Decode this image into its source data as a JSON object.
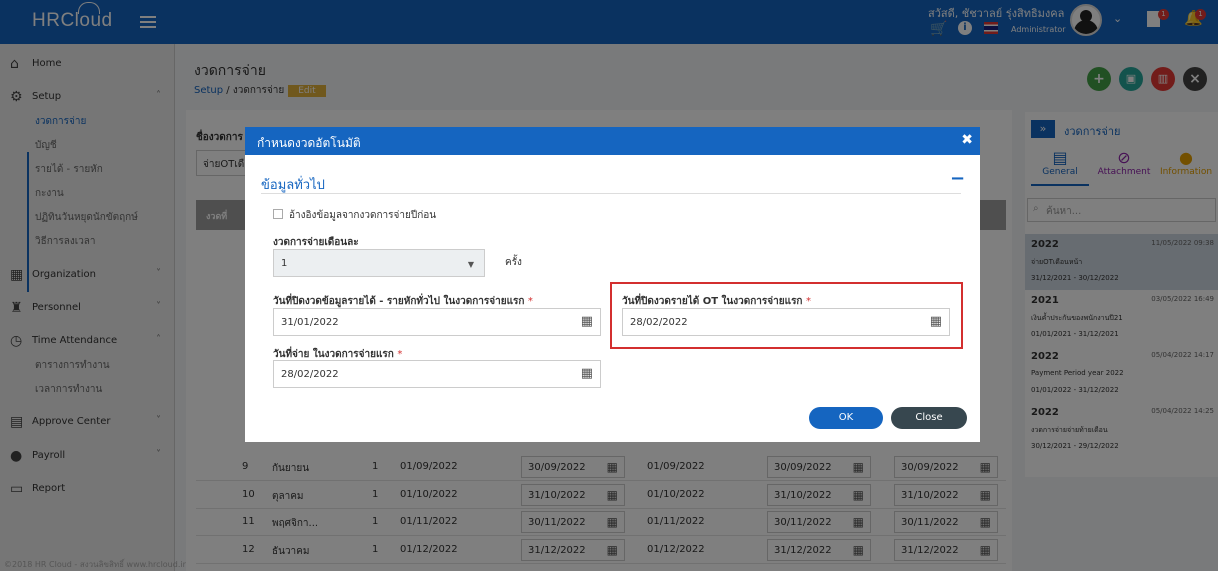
{
  "app": {
    "logo": "HRCloud",
    "username": "สวัสดี, ชัชวาลย์ รุ่งสิทธิมงคล",
    "role": "Administrator",
    "doc_badge": "1",
    "bell_badge": "1"
  },
  "sidebar": {
    "items": [
      {
        "label": "Home",
        "icon": "home-icon"
      },
      {
        "label": "Setup",
        "icon": "gear-icon"
      },
      {
        "label": "Organization",
        "icon": "building-icon"
      },
      {
        "label": "Personnel",
        "icon": "people-icon"
      },
      {
        "label": "Time Attendance",
        "icon": "clock-icon"
      },
      {
        "label": "Approve Center",
        "icon": "clipboard-icon"
      },
      {
        "label": "Payroll",
        "icon": "money-bag-icon"
      },
      {
        "label": "Report",
        "icon": "document-icon"
      }
    ],
    "setup_sub": [
      "งวดการจ่าย",
      "บัญชี",
      "รายได้ - รายหัก",
      "กะงาน",
      "ปฏิทินวันหยุดนักขัตฤกษ์",
      "วิธีการลงเวลา"
    ],
    "time_sub": [
      "ตารางการทำงาน",
      "เวลาการทำงาน"
    ],
    "footer": "©2018 HR Cloud - สงวนลิขสิทธิ์ www.hrcloud.in.th"
  },
  "page": {
    "title": "งวดการจ่าย",
    "breadcrumb_root": "Setup",
    "breadcrumb_sep": "/",
    "breadcrumb_current": "งวดการจ่าย",
    "mode": "Edit",
    "form_label": "ชื่องวดการ",
    "form_value": "จ่ายOTเดือ",
    "table_first_col": "งวดที่"
  },
  "table": {
    "rows": [
      {
        "no": "9",
        "month": "กันยายน",
        "times": "1",
        "start": "01/09/2022",
        "end": "30/09/2022",
        "ot_start": "01/09/2022",
        "ot_end": "30/09/2022",
        "pay": "30/09/2022"
      },
      {
        "no": "10",
        "month": "ตุลาคม",
        "times": "1",
        "start": "01/10/2022",
        "end": "31/10/2022",
        "ot_start": "01/10/2022",
        "ot_end": "31/10/2022",
        "pay": "31/10/2022"
      },
      {
        "no": "11",
        "month": "พฤศจิกา...",
        "times": "1",
        "start": "01/11/2022",
        "end": "30/11/2022",
        "ot_start": "01/11/2022",
        "ot_end": "30/11/2022",
        "pay": "30/11/2022"
      },
      {
        "no": "12",
        "month": "ธันวาคม",
        "times": "1",
        "start": "01/12/2022",
        "end": "31/12/2022",
        "ot_start": "01/12/2022",
        "ot_end": "31/12/2022",
        "pay": "31/12/2022"
      }
    ]
  },
  "right_panel": {
    "title": "งวดการจ่าย",
    "tabs": [
      "General",
      "Attachment",
      "Information"
    ],
    "search_placeholder": "ค้นหา...",
    "history": [
      {
        "year": "2022",
        "timestamp": "11/05/2022 09:38",
        "desc": "จ่ายOTเดือนหน้า",
        "range": "31/12/2021 - 30/12/2022"
      },
      {
        "year": "2021",
        "timestamp": "03/05/2022 16:49",
        "desc": "เงินค้ำประกันของพนักงานปี21",
        "range": "01/01/2021 - 31/12/2021"
      },
      {
        "year": "2022",
        "timestamp": "05/04/2022 14:17",
        "desc": "Payment Period year 2022",
        "range": "01/01/2022 - 31/12/2022"
      },
      {
        "year": "2022",
        "timestamp": "05/04/2022 14:25",
        "desc": "งวดการจ่ายจ่ายท้ายเดือน",
        "range": "30/12/2021 - 29/12/2022"
      }
    ]
  },
  "modal": {
    "title": "กำหนดงวดอัตโนมัติ",
    "section": "ข้อมูลทั่วไป",
    "checkbox_label": "อ้างอิงข้อมูลจากงวดการจ่ายปีก่อน",
    "per_month_label": "งวดการจ่ายเดือนละ",
    "per_month_value": "1",
    "per_month_unit": "ครั้ง",
    "close_income_label": "วันที่ปิดงวดข้อมูลรายได้ - รายหักทั่วไป ในงวดการจ่ายแรก",
    "close_income_value": "31/01/2022",
    "close_ot_label": "วันที่ปิดงวดรายได้ OT ในงวดการจ่ายแรก",
    "close_ot_value": "28/02/2022",
    "pay_date_label": "วันที่จ่าย ในงวดการจ่ายแรก",
    "pay_date_value": "28/02/2022",
    "required": "*",
    "ok": "OK",
    "close": "Close"
  },
  "colors": {
    "primary": "#1565c0",
    "danger": "#d32f2f",
    "add": "#43a047",
    "delete": "#e53935"
  }
}
